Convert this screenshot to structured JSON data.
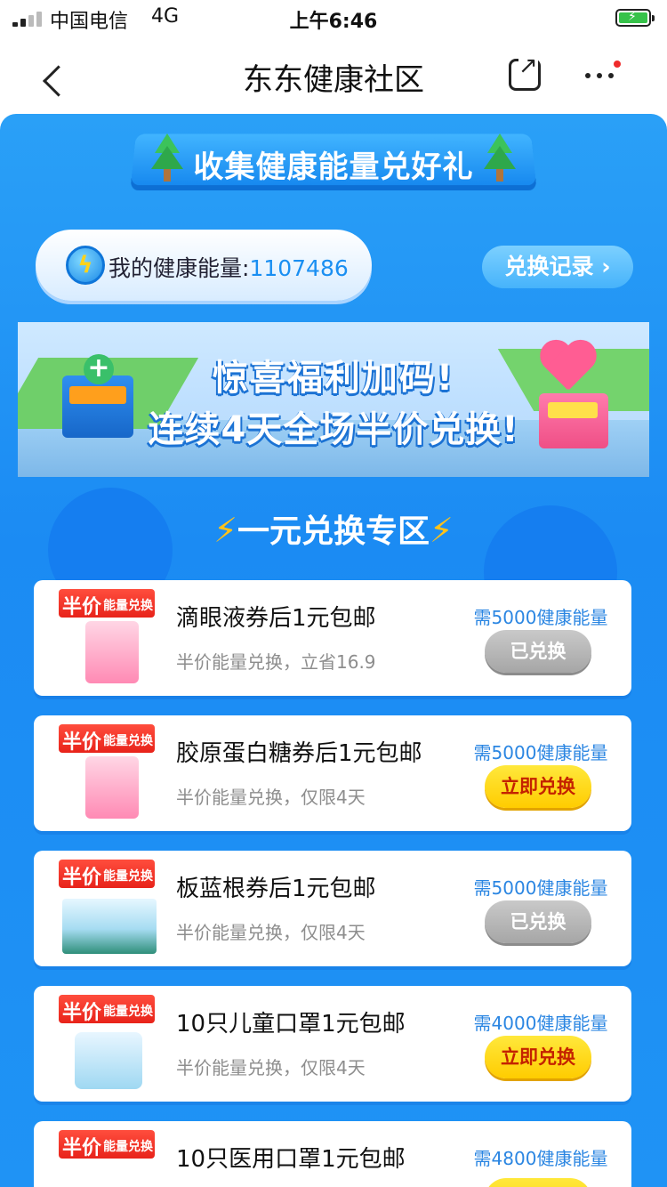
{
  "status_bar": {
    "carrier": "中国电信",
    "network": "4G",
    "time": "上午6:46"
  },
  "nav": {
    "title": "东东健康社区"
  },
  "header": {
    "title": "收集健康能量兑好礼"
  },
  "energy": {
    "label": "我的健康能量:",
    "value": "1107486"
  },
  "record_button": "兑换记录 ›",
  "banner": {
    "line1": "惊喜福利加码!",
    "line2": "连续4天全场半价兑换!"
  },
  "section": {
    "title": "一元兑换专区"
  },
  "badge": {
    "big": "半价",
    "small": "能量兑换"
  },
  "items": [
    {
      "title": "滴眼液券后1元包邮",
      "subtitle": "半价能量兑换，立省16.9",
      "cost": "需5000健康能量",
      "button": "已兑换",
      "state": "done"
    },
    {
      "title": "胶原蛋白糖券后1元包邮",
      "subtitle": "半价能量兑换，仅限4天",
      "cost": "需5000健康能量",
      "button": "立即兑换",
      "state": "available"
    },
    {
      "title": "板蓝根券后1元包邮",
      "subtitle": "半价能量兑换，仅限4天",
      "cost": "需5000健康能量",
      "button": "已兑换",
      "state": "done"
    },
    {
      "title": "10只儿童口罩1元包邮",
      "subtitle": "半价能量兑换，仅限4天",
      "cost": "需4000健康能量",
      "button": "立即兑换",
      "state": "available"
    },
    {
      "title": "10只医用口罩1元包邮",
      "subtitle": "",
      "cost": "需4800健康能量",
      "button": "",
      "state": "available"
    }
  ],
  "colors": {
    "background_blue": "#1b8bf3",
    "accent_blue": "#2b86e2",
    "badge_red": "#e8231a",
    "button_yellow": "#ffcc00",
    "button_disabled": "#a6a6a6"
  },
  "icons": [
    "signal-icon",
    "battery-icon",
    "back-arrow-icon",
    "share-icon",
    "more-icon",
    "lightning-icon",
    "tree-icon"
  ]
}
